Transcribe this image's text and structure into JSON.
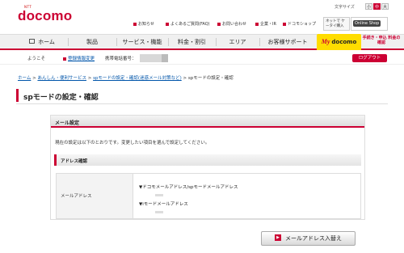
{
  "header": {
    "logo_top": "NTT",
    "logo": "docomo",
    "font_size_label": "文字サイズ",
    "font_sizes": [
      "小",
      "中",
      "大"
    ],
    "util_links": [
      "お知らせ",
      "よくあるご質問(FAQ)",
      "お問い合わせ",
      "企業・IR",
      "ドコモショップ"
    ],
    "banner_net": "ネットで ケータイ購入",
    "banner_shop": "Online Shop"
  },
  "nav": {
    "items": [
      "ホーム",
      "製品",
      "サービス・機能",
      "料金・割引",
      "エリア",
      "お客様サポート"
    ],
    "my_docomo": "docomo",
    "my_prefix": "My",
    "procedures": "手続き・申込 料金の確認"
  },
  "userbar": {
    "greeting": "ようこそ",
    "member_info_link": "登録情報変更",
    "phone_label": "携帯電話番号：",
    "logout": "ログアウト"
  },
  "breadcrumb": {
    "items": [
      "ホーム",
      "あんしん・便利サービス",
      "spモードの設定・確認(迷惑メール対策など)"
    ],
    "current": "spモードの設定・確認"
  },
  "page": {
    "title": "spモードの設定・確認"
  },
  "mail_settings": {
    "header": "メール設定",
    "description": "現在の設定は以下のとおりです。変更したい項目を選んで設定してください。",
    "section_title": "アドレス確認",
    "row_label": "メールアドレス",
    "docomo_address_label": "▼ドコモメールアドレス/spモードメールアドレス",
    "imode_address_label": "▼iモードメールアドレス",
    "swap_button": "メールアドレス入替え"
  },
  "colors": {
    "brand": "#cc0033",
    "my_docomo_bg": "#ffdd00"
  }
}
